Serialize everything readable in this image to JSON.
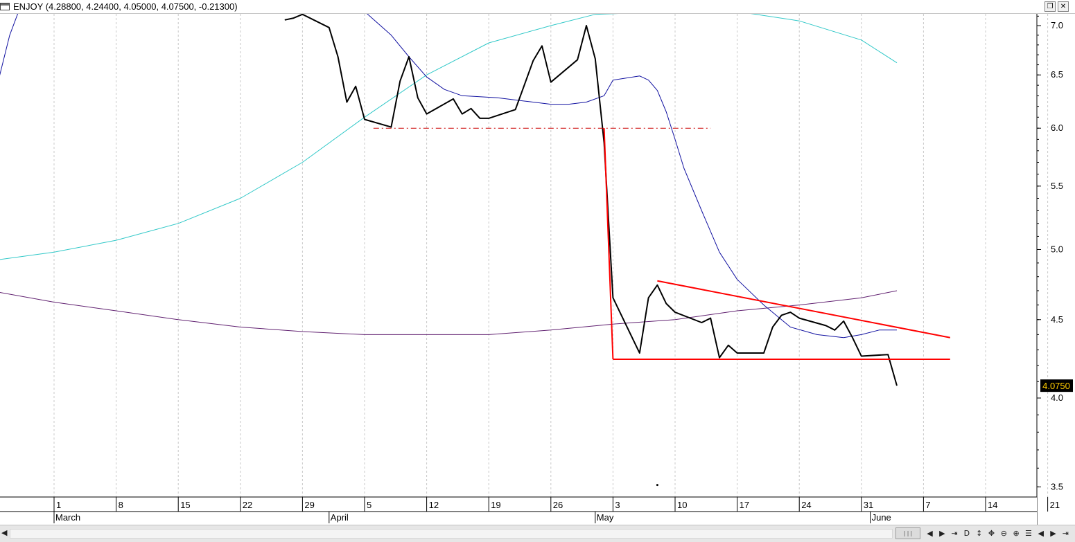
{
  "window": {
    "title": "ENJOY (4.28800, 4.24400, 4.05000, 4.07500, -0.21300)",
    "restore_icon": "restore-window-icon",
    "close_icon": "close-window-icon"
  },
  "chart_data": {
    "type": "line",
    "y_scale": "log",
    "ylim": [
      3.45,
      7.15
    ],
    "y_ticks": [
      "7.0",
      "6.5",
      "6.0",
      "5.5",
      "5.0",
      "4.5",
      "4.0",
      "3.5"
    ],
    "x_ticks": [
      {
        "label": "22",
        "date": "2024-02-22"
      },
      {
        "label": "1",
        "date": "2024-03-01"
      },
      {
        "label": "8",
        "date": "2024-03-08"
      },
      {
        "label": "15",
        "date": "2024-03-15"
      },
      {
        "label": "22",
        "date": "2024-03-22"
      },
      {
        "label": "29",
        "date": "2024-03-29"
      },
      {
        "label": "5",
        "date": "2024-04-05"
      },
      {
        "label": "12",
        "date": "2024-04-12"
      },
      {
        "label": "19",
        "date": "2024-04-19"
      },
      {
        "label": "26",
        "date": "2024-04-26"
      },
      {
        "label": "3",
        "date": "2024-05-03"
      },
      {
        "label": "10",
        "date": "2024-05-10"
      },
      {
        "label": "17",
        "date": "2024-05-17"
      },
      {
        "label": "24",
        "date": "2024-05-24"
      },
      {
        "label": "31",
        "date": "2024-05-31"
      },
      {
        "label": "7",
        "date": "2024-06-07"
      },
      {
        "label": "14",
        "date": "2024-06-14"
      },
      {
        "label": "21",
        "date": "2024-06-21"
      }
    ],
    "months": [
      {
        "label": "March",
        "date": "2024-03-01"
      },
      {
        "label": "April",
        "date": "2024-04-01"
      },
      {
        "label": "May",
        "date": "2024-05-01"
      },
      {
        "label": "June",
        "date": "2024-06-01"
      }
    ],
    "grid": "vertical-dashed",
    "last_value": "4.0750",
    "series": [
      {
        "role": "price",
        "color": "#000000",
        "points": [
          [
            "2024-03-27",
            7.06
          ],
          [
            "2024-03-28",
            7.08
          ],
          [
            "2024-03-29",
            7.12
          ],
          [
            "2024-04-01",
            6.98
          ],
          [
            "2024-04-02",
            6.68
          ],
          [
            "2024-04-03",
            6.24
          ],
          [
            "2024-04-04",
            6.39
          ],
          [
            "2024-04-05",
            6.08
          ],
          [
            "2024-04-08",
            6.01
          ],
          [
            "2024-04-09",
            6.44
          ],
          [
            "2024-04-10",
            6.68
          ],
          [
            "2024-04-11",
            6.28
          ],
          [
            "2024-04-12",
            6.13
          ],
          [
            "2024-04-15",
            6.27
          ],
          [
            "2024-04-16",
            6.13
          ],
          [
            "2024-04-17",
            6.18
          ],
          [
            "2024-04-18",
            6.09
          ],
          [
            "2024-04-19",
            6.09
          ],
          [
            "2024-04-22",
            6.17
          ],
          [
            "2024-04-23",
            6.4
          ],
          [
            "2024-04-24",
            6.64
          ],
          [
            "2024-04-25",
            6.79
          ],
          [
            "2024-04-26",
            6.43
          ],
          [
            "2024-04-29",
            6.65
          ],
          [
            "2024-04-30",
            7.0
          ],
          [
            "2024-05-01",
            6.66
          ],
          [
            "2024-05-02",
            5.87
          ],
          [
            "2024-05-03",
            4.65
          ],
          [
            "2024-05-06",
            4.28
          ],
          [
            "2024-05-07",
            4.65
          ],
          [
            "2024-05-08",
            4.74
          ],
          [
            "2024-05-09",
            4.61
          ],
          [
            "2024-05-10",
            4.55
          ],
          [
            "2024-05-13",
            4.48
          ],
          [
            "2024-05-14",
            4.51
          ],
          [
            "2024-05-15",
            4.25
          ],
          [
            "2024-05-16",
            4.33
          ],
          [
            "2024-05-17",
            4.28
          ],
          [
            "2024-05-20",
            4.28
          ],
          [
            "2024-05-21",
            4.45
          ],
          [
            "2024-05-22",
            4.53
          ],
          [
            "2024-05-23",
            4.55
          ],
          [
            "2024-05-24",
            4.51
          ],
          [
            "2024-05-27",
            4.46
          ],
          [
            "2024-05-28",
            4.43
          ],
          [
            "2024-05-29",
            4.49
          ],
          [
            "2024-05-30",
            4.38
          ],
          [
            "2024-05-31",
            4.26
          ],
          [
            "2024-06-03",
            4.27
          ],
          [
            "2024-06-04",
            4.075
          ]
        ]
      },
      {
        "role": "moving-average-short",
        "color": "#1010a0",
        "points": [
          [
            "2024-02-21",
            5.55
          ],
          [
            "2024-02-23",
            6.2
          ],
          [
            "2024-02-25",
            6.9
          ],
          [
            "2024-02-26",
            7.15
          ],
          [
            "2024-04-05",
            7.15
          ],
          [
            "2024-04-08",
            6.9
          ],
          [
            "2024-04-10",
            6.68
          ],
          [
            "2024-04-12",
            6.48
          ],
          [
            "2024-04-14",
            6.36
          ],
          [
            "2024-04-16",
            6.3
          ],
          [
            "2024-04-20",
            6.28
          ],
          [
            "2024-04-23",
            6.25
          ],
          [
            "2024-04-26",
            6.22
          ],
          [
            "2024-04-28",
            6.22
          ],
          [
            "2024-04-30",
            6.24
          ],
          [
            "2024-05-02",
            6.3
          ],
          [
            "2024-05-03",
            6.45
          ],
          [
            "2024-05-06",
            6.49
          ],
          [
            "2024-05-07",
            6.45
          ],
          [
            "2024-05-08",
            6.35
          ],
          [
            "2024-05-09",
            6.15
          ],
          [
            "2024-05-10",
            5.9
          ],
          [
            "2024-05-11",
            5.65
          ],
          [
            "2024-05-13",
            5.3
          ],
          [
            "2024-05-15",
            4.98
          ],
          [
            "2024-05-17",
            4.78
          ],
          [
            "2024-05-20",
            4.6
          ],
          [
            "2024-05-23",
            4.45
          ],
          [
            "2024-05-26",
            4.4
          ],
          [
            "2024-05-29",
            4.38
          ],
          [
            "2024-05-31",
            4.4
          ],
          [
            "2024-06-02",
            4.43
          ],
          [
            "2024-06-04",
            4.43
          ]
        ]
      },
      {
        "role": "moving-average-medium",
        "color": "#30c8c8",
        "points": [
          [
            "2024-02-21",
            4.9
          ],
          [
            "2024-03-01",
            4.98
          ],
          [
            "2024-03-08",
            5.07
          ],
          [
            "2024-03-15",
            5.2
          ],
          [
            "2024-03-22",
            5.4
          ],
          [
            "2024-03-29",
            5.7
          ],
          [
            "2024-04-05",
            6.1
          ],
          [
            "2024-04-12",
            6.5
          ],
          [
            "2024-04-19",
            6.82
          ],
          [
            "2024-04-26",
            7.0
          ],
          [
            "2024-05-01",
            7.12
          ],
          [
            "2024-05-10",
            7.15
          ],
          [
            "2024-05-17",
            7.15
          ],
          [
            "2024-05-24",
            7.05
          ],
          [
            "2024-05-31",
            6.85
          ],
          [
            "2024-06-04",
            6.62
          ]
        ]
      },
      {
        "role": "moving-average-long",
        "color": "#602070",
        "points": [
          [
            "2024-02-21",
            4.72
          ],
          [
            "2024-03-01",
            4.62
          ],
          [
            "2024-03-08",
            4.56
          ],
          [
            "2024-03-15",
            4.5
          ],
          [
            "2024-03-22",
            4.45
          ],
          [
            "2024-03-29",
            4.42
          ],
          [
            "2024-04-05",
            4.4
          ],
          [
            "2024-04-12",
            4.4
          ],
          [
            "2024-04-19",
            4.4
          ],
          [
            "2024-04-26",
            4.43
          ],
          [
            "2024-05-03",
            4.47
          ],
          [
            "2024-05-10",
            4.5
          ],
          [
            "2024-05-17",
            4.56
          ],
          [
            "2024-05-24",
            4.6
          ],
          [
            "2024-05-31",
            4.65
          ],
          [
            "2024-06-04",
            4.7
          ]
        ]
      }
    ],
    "drawings": [
      {
        "kind": "dash-dot-horizontal",
        "color": "#cc0000",
        "from": [
          "2024-04-06",
          6.0
        ],
        "to": [
          "2024-05-14",
          6.0
        ]
      },
      {
        "kind": "line",
        "color": "#ff0000",
        "from": [
          "2024-05-02",
          6.0
        ],
        "to": [
          "2024-05-03",
          4.24
        ]
      },
      {
        "kind": "line",
        "color": "#ff0000",
        "from": [
          "2024-05-03",
          4.24
        ],
        "to": [
          "2024-06-10",
          4.24
        ]
      },
      {
        "kind": "line",
        "color": "#ff0000",
        "from": [
          "2024-05-08",
          4.77
        ],
        "to": [
          "2024-06-10",
          4.38
        ]
      }
    ],
    "marker": {
      "date": "2024-05-08",
      "value": 3.51
    }
  },
  "toolbar": {
    "buttons": [
      {
        "name": "scroll-left-button",
        "glyph": "◀"
      },
      {
        "name": "scroll-right-button",
        "glyph": "▶"
      },
      {
        "name": "scroll-end-button",
        "glyph": "⇥"
      },
      {
        "name": "period-daily-button",
        "glyph": "D"
      },
      {
        "name": "cursor-button",
        "glyph": "↕"
      },
      {
        "name": "crosshair-button",
        "glyph": "✥"
      },
      {
        "name": "zoom-out-button",
        "glyph": "⊖"
      },
      {
        "name": "zoom-in-button",
        "glyph": "⊕"
      },
      {
        "name": "menu-button",
        "glyph": "☰"
      },
      {
        "name": "page-left-button",
        "glyph": "◀"
      },
      {
        "name": "page-right-button",
        "glyph": "▶"
      },
      {
        "name": "page-end-button",
        "glyph": "⇥"
      }
    ]
  }
}
